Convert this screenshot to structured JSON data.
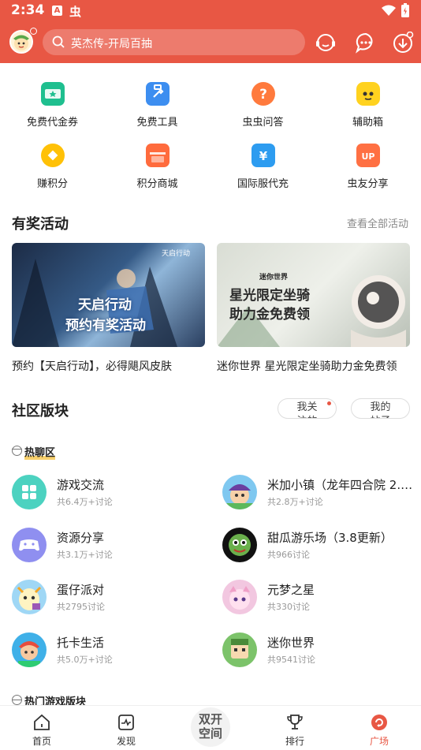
{
  "status": {
    "time": "2:34",
    "icon_a": "A",
    "icon_b": "虫"
  },
  "header": {
    "search_placeholder": "英杰传-开局百抽"
  },
  "quick_links": [
    {
      "label": "免费代金券",
      "color": "#1fbf8f"
    },
    {
      "label": "免费工具",
      "color": "#3d8ef0"
    },
    {
      "label": "虫虫问答",
      "color": "#ff7a3d"
    },
    {
      "label": "辅助箱",
      "color": "#ffd21f"
    },
    {
      "label": "赚积分",
      "color": "#ffc107"
    },
    {
      "label": "积分商城",
      "color": "#ff6b3d"
    },
    {
      "label": "国际服代充",
      "color": "#2d9cf0"
    },
    {
      "label": "虫友分享",
      "color": "#ff7043"
    }
  ],
  "activities": {
    "title": "有奖活动",
    "more": "查看全部活动",
    "items": [
      {
        "caption": "预约【天启行动】，必得飓风皮肤",
        "banner_text_1": "天启行动",
        "banner_text_2": "预约有奖活动",
        "banner_logo": "天启行动"
      },
      {
        "caption": "迷你世界 星光限定坐骑助力金免费领",
        "banner_text_1": "星光限定坐骑",
        "banner_text_2": "助力金免费领",
        "banner_logo": "迷你世界"
      }
    ]
  },
  "community": {
    "title": "社区版块",
    "pill_follow": "我关注的",
    "pill_posts": "我的帖子",
    "hot_chat": "热聊区",
    "hot_games": "热门游戏版块",
    "items": [
      {
        "name": "游戏交流",
        "count": "共6.4万+讨论"
      },
      {
        "name": "米加小镇（龙年四合院 2.2…",
        "count": "共2.8万+讨论"
      },
      {
        "name": "资源分享",
        "count": "共3.1万+讨论"
      },
      {
        "name": "甜瓜游乐场（3.8更新）",
        "count": "共966讨论"
      },
      {
        "name": "蛋仔派对",
        "count": "共2795讨论"
      },
      {
        "name": "元梦之星",
        "count": "共330讨论"
      },
      {
        "name": "托卡生活",
        "count": "共5.0万+讨论"
      },
      {
        "name": "迷你世界",
        "count": "共9541讨论"
      }
    ]
  },
  "tabs": [
    {
      "label": "首页"
    },
    {
      "label": "发现"
    },
    {
      "label": "双开空间"
    },
    {
      "label": "排行"
    },
    {
      "label": "广场"
    }
  ],
  "colors": {
    "brand": "#e85744",
    "accent_tab": "#e85744"
  }
}
